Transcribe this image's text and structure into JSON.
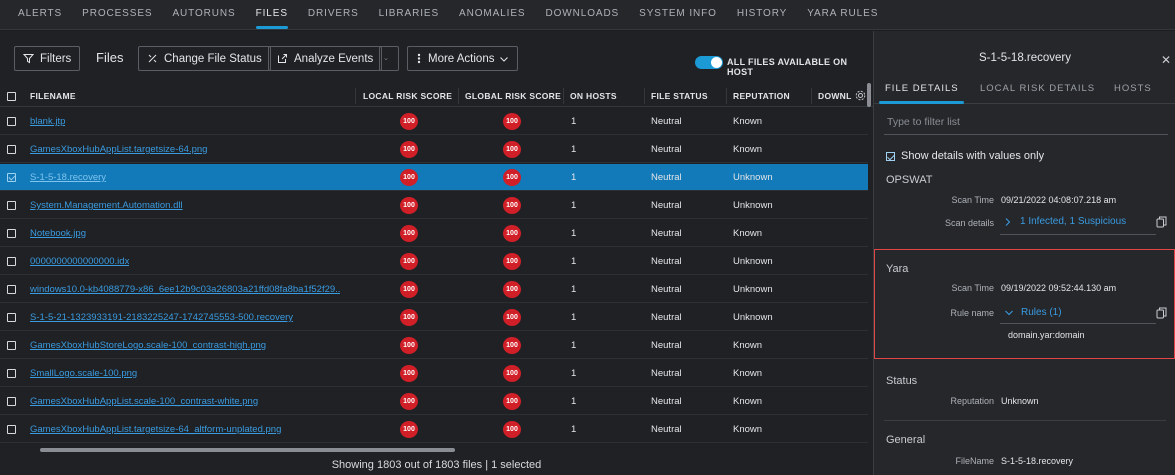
{
  "nav": {
    "tabs": [
      "ALERTS",
      "PROCESSES",
      "AUTORUNS",
      "FILES",
      "DRIVERS",
      "LIBRARIES",
      "ANOMALIES",
      "DOWNLOADS",
      "SYSTEM INFO",
      "HISTORY",
      "YARA RULES"
    ],
    "active": "FILES"
  },
  "toolbar": {
    "filters_label": "Filters",
    "files_label": "Files",
    "change_status_label": "Change File Status",
    "analyze_label": "Analyze Events",
    "more_actions_label": "More Actions",
    "toggle_label": "ALL FILES AVAILABLE ON HOST",
    "toggle_on": true
  },
  "table": {
    "columns": [
      "FILENAME",
      "LOCAL RISK SCORE",
      "GLOBAL RISK SCORE",
      "ON HOSTS",
      "FILE STATUS",
      "REPUTATION",
      "DOWNLC"
    ],
    "rows": [
      {
        "filename": "blank.jtp",
        "local": "100",
        "global": "100",
        "hosts": "1",
        "status": "Neutral",
        "reputation": "Known",
        "selected": false
      },
      {
        "filename": "GamesXboxHubAppList.targetsize-64.png",
        "local": "100",
        "global": "100",
        "hosts": "1",
        "status": "Neutral",
        "reputation": "Known",
        "selected": false
      },
      {
        "filename": "S-1-5-18.recovery",
        "local": "100",
        "global": "100",
        "hosts": "1",
        "status": "Neutral",
        "reputation": "Unknown",
        "selected": true
      },
      {
        "filename": "System.Management.Automation.dll",
        "local": "100",
        "global": "100",
        "hosts": "1",
        "status": "Neutral",
        "reputation": "Unknown",
        "selected": false
      },
      {
        "filename": "Notebook.jpg",
        "local": "100",
        "global": "100",
        "hosts": "1",
        "status": "Neutral",
        "reputation": "Known",
        "selected": false
      },
      {
        "filename": "0000000000000000.idx",
        "local": "100",
        "global": "100",
        "hosts": "1",
        "status": "Neutral",
        "reputation": "Unknown",
        "selected": false
      },
      {
        "filename": "windows10.0-kb4088779-x86_6ee12b9c03a26803a21ffd08fa8ba1f52f29...",
        "local": "100",
        "global": "100",
        "hosts": "1",
        "status": "Neutral",
        "reputation": "Unknown",
        "selected": false
      },
      {
        "filename": "S-1-5-21-1323933191-2183225247-1742745553-500.recovery",
        "local": "100",
        "global": "100",
        "hosts": "1",
        "status": "Neutral",
        "reputation": "Unknown",
        "selected": false
      },
      {
        "filename": "GamesXboxHubStoreLogo.scale-100_contrast-high.png",
        "local": "100",
        "global": "100",
        "hosts": "1",
        "status": "Neutral",
        "reputation": "Known",
        "selected": false
      },
      {
        "filename": "SmallLogo.scale-100.png",
        "local": "100",
        "global": "100",
        "hosts": "1",
        "status": "Neutral",
        "reputation": "Known",
        "selected": false
      },
      {
        "filename": "GamesXboxHubAppList.scale-100_contrast-white.png",
        "local": "100",
        "global": "100",
        "hosts": "1",
        "status": "Neutral",
        "reputation": "Known",
        "selected": false
      },
      {
        "filename": "GamesXboxHubAppList.targetsize-64_altform-unplated.png",
        "local": "100",
        "global": "100",
        "hosts": "1",
        "status": "Neutral",
        "reputation": "Known",
        "selected": false
      }
    ],
    "footer": "Showing 1803 out of 1803 files | 1 selected"
  },
  "panel": {
    "title": "S-1-5-18.recovery",
    "tabs": [
      "FILE DETAILS",
      "LOCAL RISK DETAILS",
      "HOSTS"
    ],
    "filter_placeholder": "Type to filter list",
    "show_details_label": "Show details with values only",
    "opswat": {
      "title": "OPSWAT",
      "scan_time_label": "Scan Time",
      "scan_time": "09/21/2022 04:08:07.218 am",
      "scan_details_label": "Scan details",
      "scan_details": "1 Infected, 1 Suspicious"
    },
    "yara": {
      "title": "Yara",
      "scan_time_label": "Scan Time",
      "scan_time": "09/19/2022 09:52:44.130 am",
      "rule_name_label": "Rule name",
      "rules_link": "Rules (1)",
      "rule": "domain.yar:domain"
    },
    "status": {
      "title": "Status",
      "reputation_label": "Reputation",
      "reputation": "Unknown"
    },
    "general": {
      "title": "General",
      "filename_label": "FileName",
      "filename": "S-1-5-18.recovery"
    }
  },
  "colors": {
    "accent": "#1b9ad6",
    "selected_row": "#127ab8",
    "risk_badge": "#d11f28",
    "highlight_box": "#e24545",
    "link": "#3a9be0"
  }
}
